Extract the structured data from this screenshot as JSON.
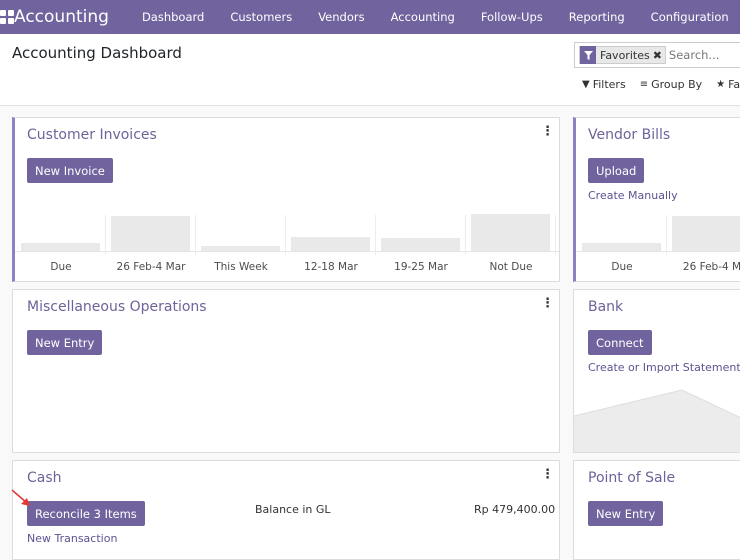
{
  "navbar": {
    "app_name": "Accounting",
    "menu": [
      "Dashboard",
      "Customers",
      "Vendors",
      "Accounting",
      "Follow-Ups",
      "Reporting",
      "Configuration"
    ]
  },
  "control_panel": {
    "title": "Accounting Dashboard",
    "search": {
      "facet_label": "Favorites",
      "placeholder": "Search..."
    },
    "buttons": {
      "filters": "Filters",
      "group_by": "Group By",
      "favorites": "Favo"
    }
  },
  "cards": {
    "customer_invoices": {
      "title": "Customer Invoices",
      "button": "New Invoice",
      "graph": {
        "labels": [
          "Due",
          "26 Feb-4 Mar",
          "This Week",
          "12-18 Mar",
          "19-25 Mar",
          "Not Due"
        ],
        "values": [
          0.22,
          0.92,
          0.14,
          0.36,
          0.33,
          0.97
        ]
      }
    },
    "vendor_bills": {
      "title": "Vendor Bills",
      "button": "Upload",
      "link": "Create Manually",
      "graph": {
        "labels": [
          "Due",
          "26 Feb-4 M"
        ],
        "values": [
          0.2,
          0.92
        ]
      }
    },
    "misc": {
      "title": "Miscellaneous Operations",
      "button": "New Entry"
    },
    "bank": {
      "title": "Bank",
      "button": "Connect",
      "link": "Create or Import Statements"
    },
    "cash": {
      "title": "Cash",
      "button": "Reconcile 3 Items",
      "link": "New Transaction",
      "balance_label": "Balance in GL",
      "balance_value": "Rp 479,400.00"
    },
    "pos": {
      "title": "Point of Sale",
      "button": "New Entry"
    }
  },
  "colors": {
    "brand": "#71639e",
    "accent": "#8f7fc4",
    "annotation_arrow": "#e53935"
  }
}
